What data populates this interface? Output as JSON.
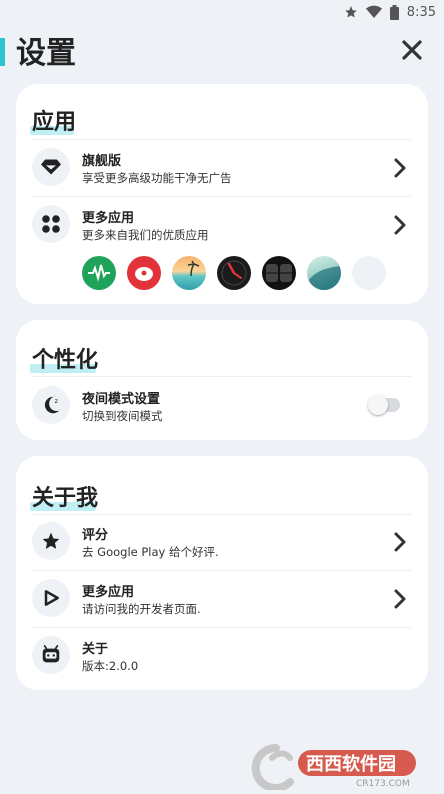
{
  "status_bar": {
    "time": "8:35"
  },
  "header": {
    "title": "设置"
  },
  "sections": {
    "apps": {
      "title": "应用",
      "rows": [
        {
          "title": "旗舰版",
          "subtitle": "享受更多高级功能干净无广告"
        },
        {
          "title": "更多应用",
          "subtitle": "更多来自我们的优质应用"
        }
      ],
      "app_icons": [
        "sound-wave-app-icon",
        "piggy-bank-app-icon",
        "beach-app-icon",
        "clock-app-icon",
        "flip-clock-app-icon",
        "wave-app-icon",
        "placeholder-app-icon"
      ]
    },
    "personalize": {
      "title": "个性化",
      "rows": [
        {
          "title": "夜间模式设置",
          "subtitle": "切换到夜间模式",
          "toggle_on": false
        }
      ]
    },
    "about": {
      "title": "关于我",
      "rows": [
        {
          "title": "评分",
          "subtitle": "去 Google Play 给个好评."
        },
        {
          "title": "更多应用",
          "subtitle": "请访问我的开发者页面."
        },
        {
          "title": "关于",
          "subtitle": "版本:2.0.0"
        }
      ]
    }
  },
  "watermark": {
    "brand": "西西软件园",
    "url": "CR173.COM"
  },
  "colors": {
    "accent": "#2ec4d6",
    "highlight": "#bfeef4",
    "background": "#eef2f7"
  }
}
